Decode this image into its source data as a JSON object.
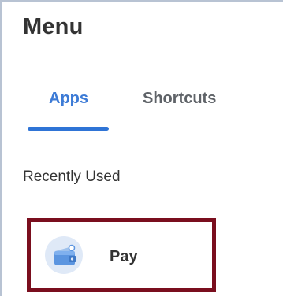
{
  "menu": {
    "title": "Menu"
  },
  "tabs": [
    {
      "label": "Apps",
      "selected": true
    },
    {
      "label": "Shortcuts",
      "selected": false
    }
  ],
  "recent": {
    "section_label": "Recently Used",
    "items": [
      {
        "label": "Pay",
        "icon": "wallet-icon"
      }
    ]
  },
  "colors": {
    "accent": "#2f74d6",
    "highlight_border": "#7a0e1e",
    "text": "#333333"
  }
}
